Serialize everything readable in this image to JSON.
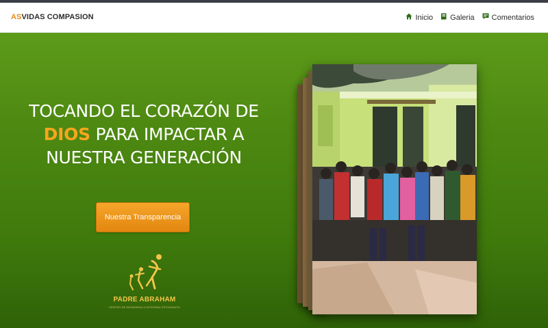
{
  "brand": {
    "accent": "AS",
    "rest": "VIDAS COMPASION"
  },
  "nav": {
    "items": [
      {
        "label": "Inicio",
        "icon": "home-icon"
      },
      {
        "label": "Galeria",
        "icon": "book-icon"
      },
      {
        "label": "Comentarios",
        "icon": "comment-icon"
      }
    ]
  },
  "hero": {
    "line1": "TOCANDO EL CORAZÓN DE",
    "highlight": "DIOS",
    "line2_rest": " PARA IMPACTAR A",
    "line3": "NUESTRA GENERACIÓN",
    "cta_label": "Nuestra Transparencia"
  },
  "logo": {
    "name": "PADRE ABRAHAM",
    "subtitle": "CENTRO DE DESARROLLO INTEGRAL ESTUDIANTIL"
  },
  "colors": {
    "accent": "#f7a51d",
    "hero_green": "#4e8a12",
    "button_orange": "#e2870f"
  }
}
